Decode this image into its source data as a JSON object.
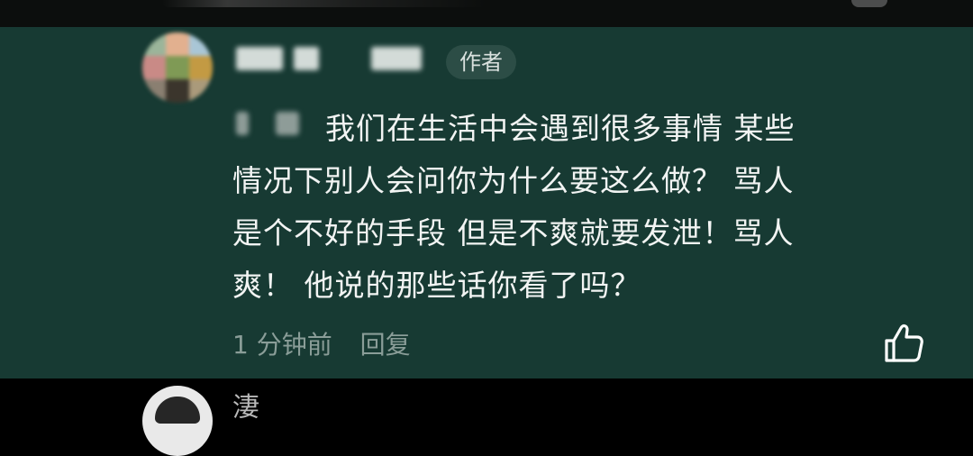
{
  "comment": {
    "author_badge": "作者",
    "text_lines": [
      "我们在生活中会遇到很多事情 某些",
      "情况下别人会问你为什么要这么做？ 骂人",
      "是个不好的手段 但是不爽就要发泄！骂人",
      "爽！ 他说的那些话你看了吗？"
    ],
    "time": "1 分钟前",
    "reply_label": "回复"
  },
  "next_comment": {
    "name_fragment": "淒"
  },
  "colors": {
    "comment_bg": "#173a33",
    "badge_bg": "#2c4d46",
    "text": "#f2f4f3",
    "meta": "#8a9d98"
  },
  "icons": [
    "like-icon"
  ]
}
